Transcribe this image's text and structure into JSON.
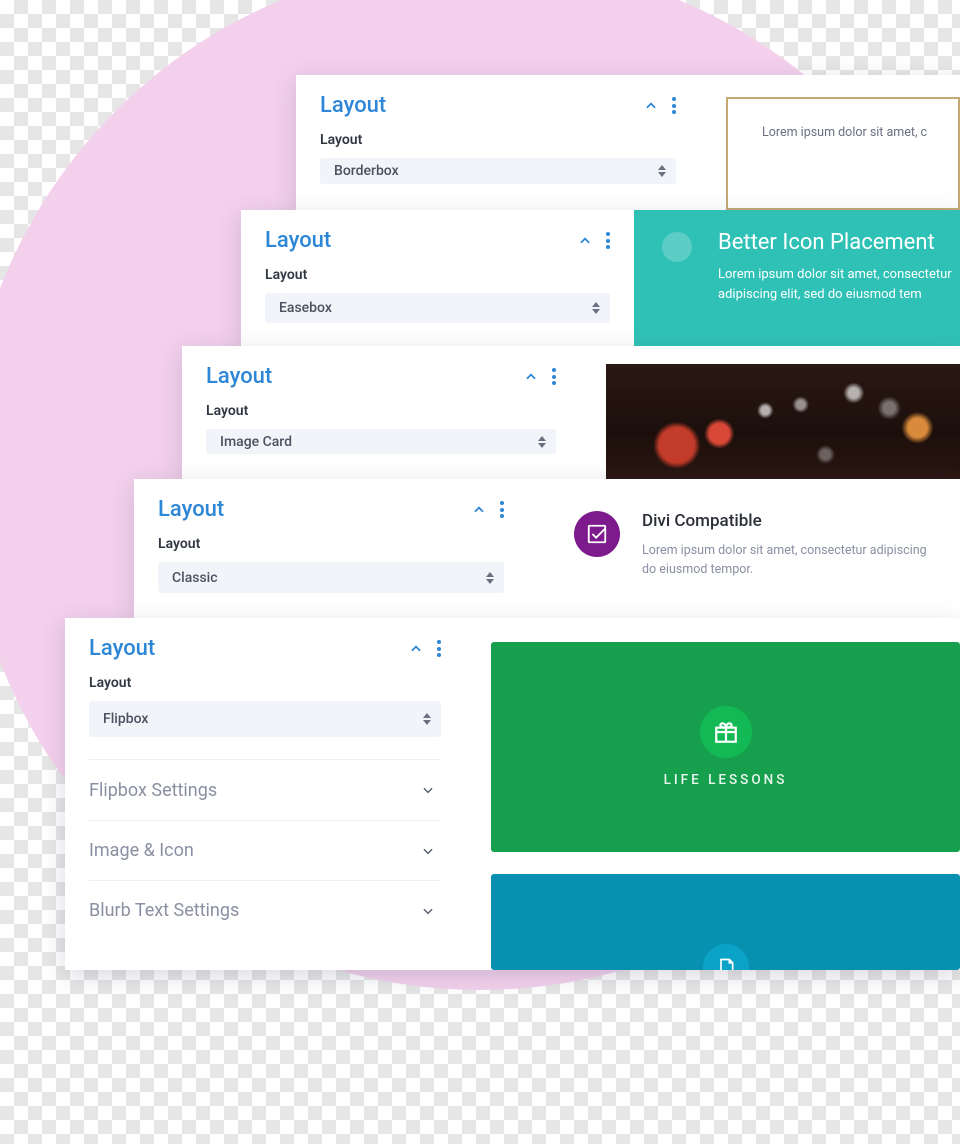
{
  "cards": [
    {
      "section_title": "Layout",
      "field_label": "Layout",
      "select_value": "Borderbox",
      "preview": {
        "body": "Lorem ipsum dolor sit amet, c"
      }
    },
    {
      "section_title": "Layout",
      "field_label": "Layout",
      "select_value": "Easebox",
      "preview": {
        "heading": "Better Icon Placement",
        "line1": "Lorem ipsum dolor sit amet, consectetur",
        "line2": "adipiscing elit, sed do eiusmod tem"
      }
    },
    {
      "section_title": "Layout",
      "field_label": "Layout",
      "select_value": "Image Card"
    },
    {
      "section_title": "Layout",
      "field_label": "Layout",
      "select_value": "Classic",
      "preview": {
        "heading": "Divi Compatible",
        "line1": "Lorem ipsum dolor sit amet, consectetur adipiscing",
        "line2": "do eiusmod tempor."
      }
    },
    {
      "section_title": "Layout",
      "field_label": "Layout",
      "select_value": "Flipbox",
      "accordion": [
        "Flipbox Settings",
        "Image & Icon",
        "Blurb Text Settings"
      ],
      "preview": {
        "green_label": "LIFE LESSONS"
      }
    }
  ]
}
